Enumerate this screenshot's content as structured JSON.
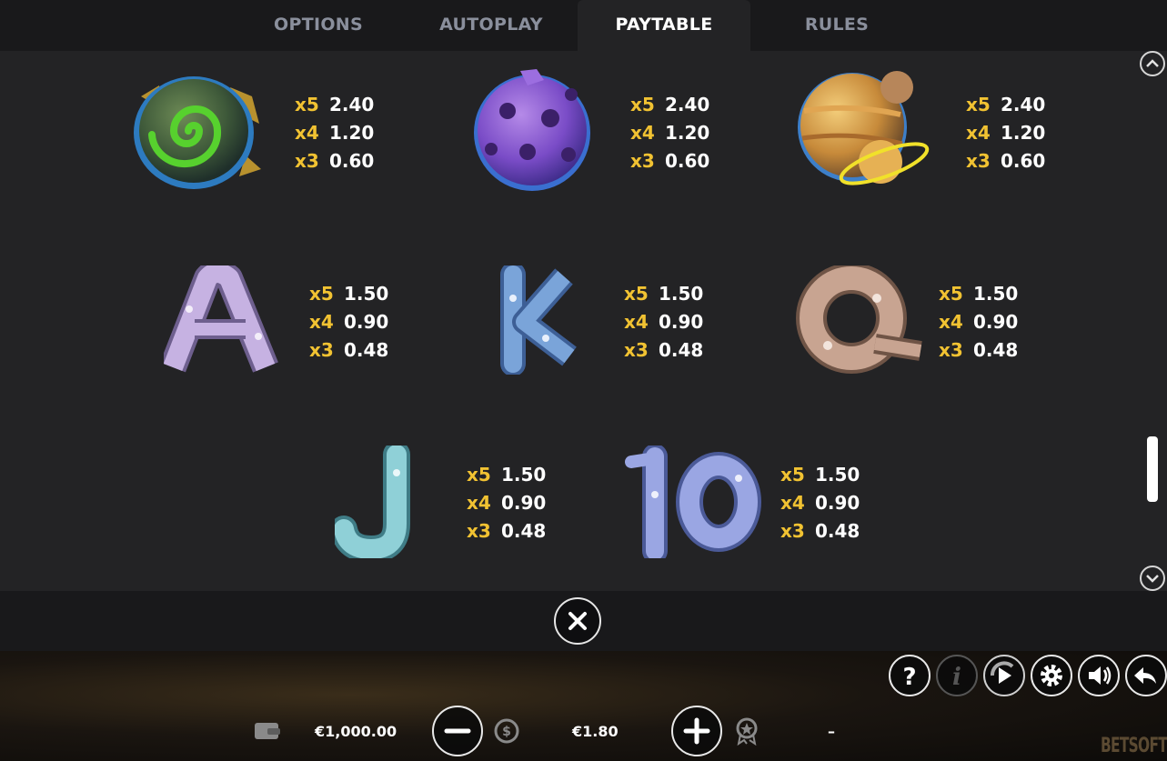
{
  "tabs": [
    {
      "label": "OPTIONS"
    },
    {
      "label": "AUTOPLAY"
    },
    {
      "label": "PAYTABLE",
      "active": true
    },
    {
      "label": "RULES"
    }
  ],
  "paytable": {
    "symbols": [
      {
        "name": "green-planet",
        "pays": [
          {
            "m": "x5",
            "v": "2.40"
          },
          {
            "m": "x4",
            "v": "1.20"
          },
          {
            "m": "x3",
            "v": "0.60"
          }
        ]
      },
      {
        "name": "purple-moon",
        "pays": [
          {
            "m": "x5",
            "v": "2.40"
          },
          {
            "m": "x4",
            "v": "1.20"
          },
          {
            "m": "x3",
            "v": "0.60"
          }
        ]
      },
      {
        "name": "orange-planet",
        "pays": [
          {
            "m": "x5",
            "v": "2.40"
          },
          {
            "m": "x4",
            "v": "1.20"
          },
          {
            "m": "x3",
            "v": "0.60"
          }
        ]
      },
      {
        "name": "letter-a",
        "pays": [
          {
            "m": "x5",
            "v": "1.50"
          },
          {
            "m": "x4",
            "v": "0.90"
          },
          {
            "m": "x3",
            "v": "0.48"
          }
        ]
      },
      {
        "name": "letter-k",
        "pays": [
          {
            "m": "x5",
            "v": "1.50"
          },
          {
            "m": "x4",
            "v": "0.90"
          },
          {
            "m": "x3",
            "v": "0.48"
          }
        ]
      },
      {
        "name": "letter-q",
        "pays": [
          {
            "m": "x5",
            "v": "1.50"
          },
          {
            "m": "x4",
            "v": "0.90"
          },
          {
            "m": "x3",
            "v": "0.48"
          }
        ]
      },
      {
        "name": "letter-j",
        "pays": [
          {
            "m": "x5",
            "v": "1.50"
          },
          {
            "m": "x4",
            "v": "0.90"
          },
          {
            "m": "x3",
            "v": "0.48"
          }
        ]
      },
      {
        "name": "number-10",
        "pays": [
          {
            "m": "x5",
            "v": "1.50"
          },
          {
            "m": "x4",
            "v": "0.90"
          },
          {
            "m": "x3",
            "v": "0.48"
          }
        ]
      }
    ]
  },
  "footer": {
    "balance": "€1,000.00",
    "bet": "€1.80",
    "win": "–",
    "brand": "BETSOFT"
  },
  "colors": {
    "multiplier": "#f1c232",
    "value": "#ffffff",
    "tab_inactive": "#8a8f9c",
    "tab_active": "#ffffff"
  },
  "icons": {
    "wallet": "wallet-icon",
    "coins": "coins-icon",
    "award": "award-icon",
    "help": "question-icon",
    "info": "info-icon",
    "spin": "autoplay-icon",
    "settings": "gear-icon",
    "sound": "speaker-icon",
    "back": "back-arrow-icon"
  }
}
